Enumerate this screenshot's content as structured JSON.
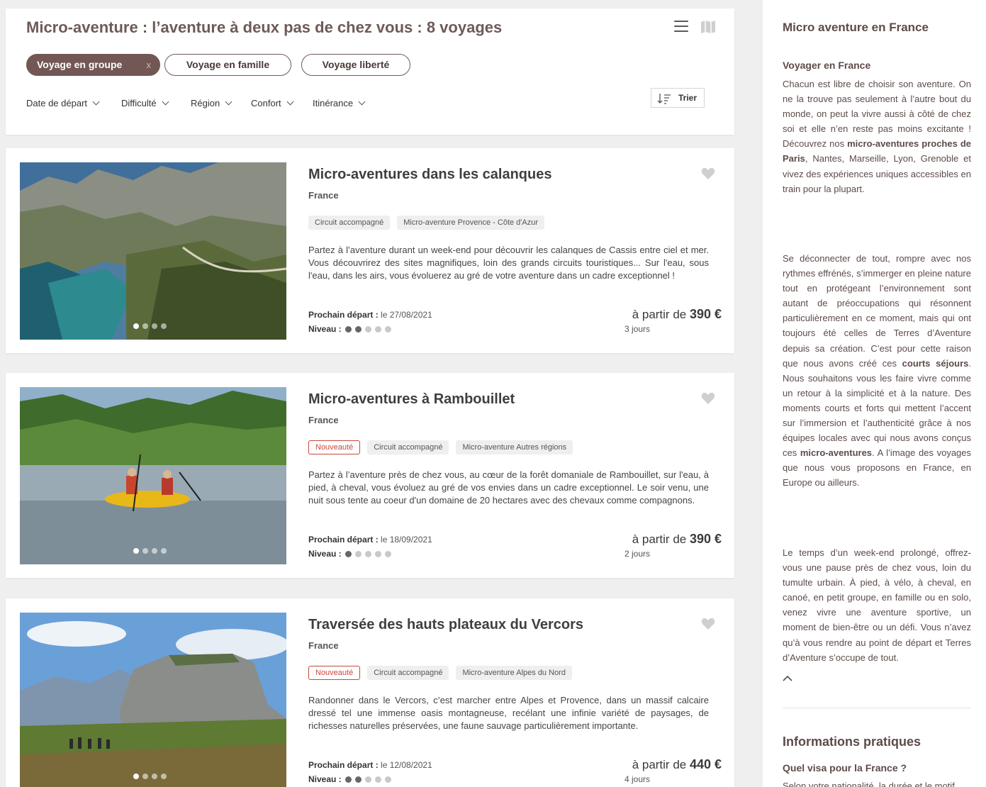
{
  "header": {
    "title": "Micro-aventure : l’aventure à deux pas de chez vous : 8 voyages",
    "chips": {
      "group": "Voyage en groupe",
      "group_remove": "x",
      "family": "Voyage en famille",
      "liberty": "Voyage liberté"
    },
    "filters": {
      "date": "Date de départ",
      "difficulty": "Difficulté",
      "region": "Région",
      "comfort": "Confort",
      "itinerancy": "Itinérance"
    },
    "sort_label": "Trier"
  },
  "cards": [
    {
      "title": "Micro-aventures dans les calanques",
      "country": "France",
      "tags": [
        "Circuit accompagné",
        "Micro-aventure Provence - Côte d'Azur"
      ],
      "description": "Partez à l’aventure durant un week-end pour découvrir les calanques de Cassis entre ciel et mer. Vous découvrirez des sites magnifiques, loin des grands circuits touristiques... Sur l'eau, sous l'eau, dans les airs, vous évoluerez au gré de votre aventure dans un cadre exceptionnel !",
      "next_departure_label": "Prochain départ :",
      "next_departure_value": " le 27/08/2021",
      "level_label": "Niveau :",
      "level": 2,
      "price_prefix": "à partir de ",
      "price": "390 €",
      "duration": "3 jours"
    },
    {
      "title": "Micro-aventures à Rambouillet",
      "country": "France",
      "new_label": "Nouveauté",
      "tags": [
        "Circuit accompagné",
        "Micro-aventure Autres régions"
      ],
      "description": "Partez à l’aventure près de chez vous, au cœur de la forêt domaniale de Rambouillet, sur l'eau, à pied, à cheval, vous évoluez au gré de vos envies dans un cadre exceptionnel. Le soir venu, une nuit sous tente au coeur d'un domaine de 20 hectares avec des chevaux comme compagnons.",
      "next_departure_label": "Prochain départ :",
      "next_departure_value": " le 18/09/2021",
      "level_label": "Niveau :",
      "level": 1,
      "price_prefix": "à partir de ",
      "price": "390 €",
      "duration": "2 jours"
    },
    {
      "title": "Traversée des hauts plateaux du Vercors",
      "country": "France",
      "new_label": "Nouveauté",
      "tags": [
        "Circuit accompagné",
        "Micro-aventure Alpes du Nord"
      ],
      "description": "Randonner dans le Vercors, c’est marcher entre Alpes et Provence, dans un massif calcaire dressé tel une immense oasis montagneuse, recélant une infinie variété de paysages, de richesses naturelles préservées, une faune sauvage particulièrement importante.",
      "next_departure_label": "Prochain départ :",
      "next_departure_value": " le 12/08/2021",
      "level_label": "Niveau :",
      "level": 2,
      "price_prefix": "à partir de ",
      "price": "440 €",
      "duration": "4 jours"
    }
  ],
  "sidebar": {
    "title": "Micro aventure en France",
    "subtitle": "Voyager en France",
    "p1_a": "Chacun est libre de choisir son aventure. On ne la trouve pas seulement à l’autre bout du monde, on peut la vivre aussi à côté de chez soi et elle n’en reste pas moins excitante ! Découvrez nos ",
    "p1_b": "micro-aventures proches de Paris",
    "p1_c": ", Nantes, Marseille, Lyon, Grenoble et vivez des expériences uniques accessibles en train pour la plupart.",
    "p2_a": "Se déconnecter de tout, rompre avec nos rythmes effrénés, s’immerger en pleine nature tout en protégeant l’environnement sont autant de préoccupations qui résonnent particulièrement en ce moment, mais qui ont toujours été celles de Terres d’Aventure depuis sa création. C’est pour cette raison que nous avons créé ces ",
    "p2_b": "courts séjours",
    "p2_c": ". Nous souhaitons vous les faire vivre comme un retour à la simplicité et à la nature. Des moments courts et forts qui mettent l’accent sur l’immersion et l’authenticité grâce à nos équipes locales avec qui nous avons conçus ces ",
    "p2_d": "micro-aventures",
    "p2_e": ". A l’image des voyages que nous vous proposons en France, en Europe ou ailleurs.",
    "p3": "Le temps d’un week-end prolongé, offrez-vous une pause près de chez vous, loin du tumulte urbain. À pied, à vélo, à cheval, en canoé, en petit groupe, en famille ou en solo, venez vivre une aventure sportive, un moment de bien-être ou un défi. Vous n’avez qu’à vous rendre au point de départ et Terres d’Aventure s’occupe de tout.",
    "info_title": "Informations pratiques",
    "visa_question": "Quel visa pour la France ?",
    "cut_text": "Selon votre nationalité, la durée et le motif"
  }
}
